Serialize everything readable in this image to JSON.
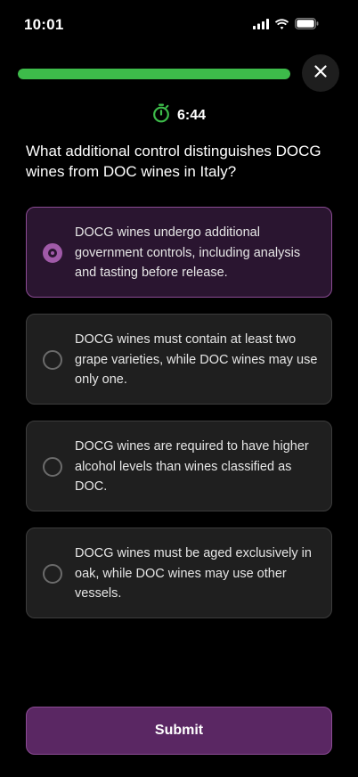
{
  "status_bar": {
    "time": "10:01",
    "icons": [
      "cellular-signal-icon",
      "wifi-icon",
      "battery-icon"
    ]
  },
  "quiz": {
    "progress": 1.0,
    "progress_color": "#3dbb4a",
    "timer": "6:44",
    "timer_icon": "stopwatch-icon",
    "question": "What additional control distinguishes DOCG wines from DOC wines in Italy?",
    "options": [
      {
        "text": "DOCG wines undergo additional government controls, including analysis and tasting before release.",
        "selected": true
      },
      {
        "text": "DOCG wines must contain at least two grape varieties, while DOC wines may use only one.",
        "selected": false
      },
      {
        "text": "DOCG wines are required to have higher alcohol levels than wines classified as DOC.",
        "selected": false
      },
      {
        "text": "DOCG wines must be aged exclusively in oak, while DOC wines may use other vessels.",
        "selected": false
      }
    ],
    "submit_label": "Submit",
    "accent_color": "#a05aa8"
  }
}
